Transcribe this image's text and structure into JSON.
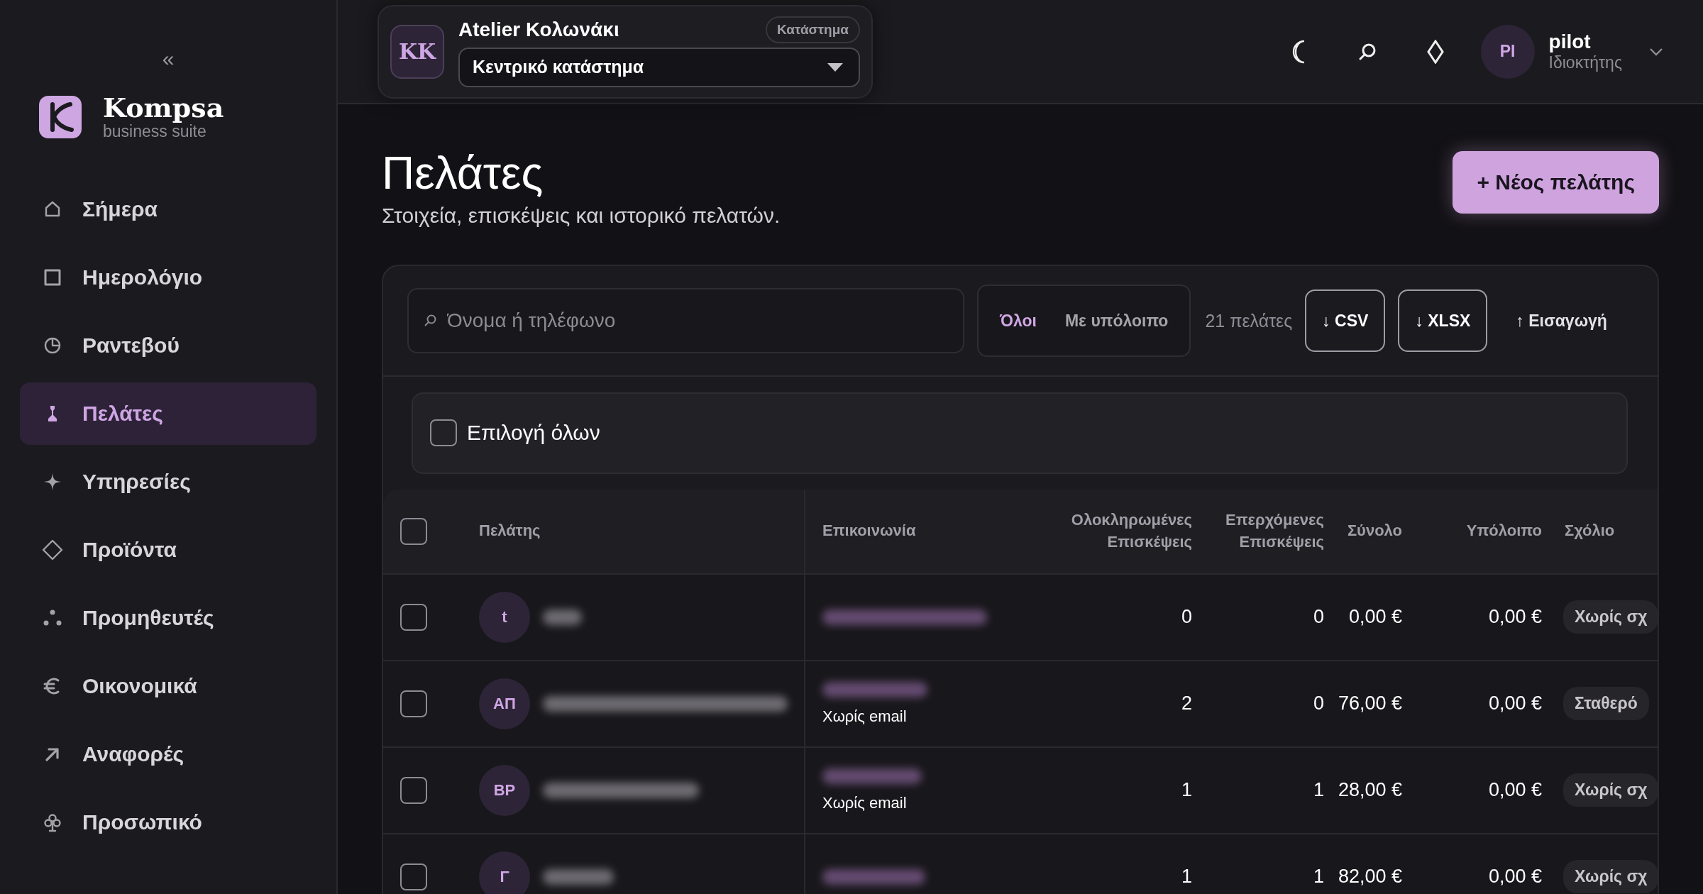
{
  "sidebar": {
    "collapse": "«",
    "brand": {
      "name": "Kompsa",
      "tagline": "business suite"
    },
    "items": [
      {
        "label": "Σήμερα",
        "selected": false
      },
      {
        "label": "Ημερολόγιο",
        "selected": false
      },
      {
        "label": "Ραντεβού",
        "selected": false
      },
      {
        "label": "Πελάτες",
        "selected": true
      },
      {
        "label": "Υπηρεσίες",
        "selected": false
      },
      {
        "label": "Προϊόντα",
        "selected": false
      },
      {
        "label": "Προμηθευτές",
        "selected": false
      },
      {
        "label": "Οικονομικά",
        "selected": false
      },
      {
        "label": "Αναφορές",
        "selected": false
      },
      {
        "label": "Προσωπικό",
        "selected": false
      }
    ]
  },
  "topbar": {
    "store": {
      "initials": "KK",
      "name": "Atelier Κολωνάκι",
      "badge": "Κατάστημα",
      "branch": "Κεντρικό κατάστημα"
    },
    "user": {
      "initials": "PI",
      "name": "pilot",
      "role": "Ιδιοκτήτης"
    }
  },
  "page": {
    "title": "Πελάτες",
    "subtitle": "Στοιχεία, επισκέψεις και ιστορικό πελατών.",
    "new_button": "+ Νέος πελάτης"
  },
  "toolbar": {
    "search": {
      "placeholder": "Όνομα ή τηλέφωνο"
    },
    "filters": [
      {
        "label": "Όλοι",
        "selected": true
      },
      {
        "label": "Με υπόλοιπο",
        "selected": false
      }
    ],
    "count": "21 πελάτες",
    "exports": [
      "↓ CSV",
      "↓ XLSX"
    ],
    "import": "↑ Εισαγωγή"
  },
  "select_all": {
    "label": "Επιλογή όλων",
    "checked": false
  },
  "table": {
    "header_checked": false,
    "columns": [
      "Πελάτης",
      "Επικοινωνία",
      "Ολοκληρωμένες Επισκέψεις",
      "Επερχόμενες Επισκέψεις",
      "Σύνολο",
      "Υπόλοιπο",
      "Σχόλιο"
    ],
    "rows": [
      {
        "checked": false,
        "initials": "t",
        "contact_note": "",
        "completed": "0",
        "upcoming": "0",
        "total": "0,00 €",
        "balance": "0,00 €",
        "note": "Χωρίς σχ"
      },
      {
        "checked": false,
        "initials": "ΑΠ",
        "contact_note": "Χωρίς email",
        "completed": "2",
        "upcoming": "0",
        "total": "76,00 €",
        "balance": "0,00 €",
        "note": "Σταθερό"
      },
      {
        "checked": false,
        "initials": "ΒΡ",
        "contact_note": "Χωρίς email",
        "completed": "1",
        "upcoming": "1",
        "total": "28,00 €",
        "balance": "0,00 €",
        "note": "Χωρίς σχ"
      },
      {
        "checked": false,
        "initials": "Γ",
        "contact_note": "",
        "completed": "1",
        "upcoming": "1",
        "total": "82,00 €",
        "balance": "0,00 €",
        "note": "Χωρίς σχ"
      }
    ]
  }
}
